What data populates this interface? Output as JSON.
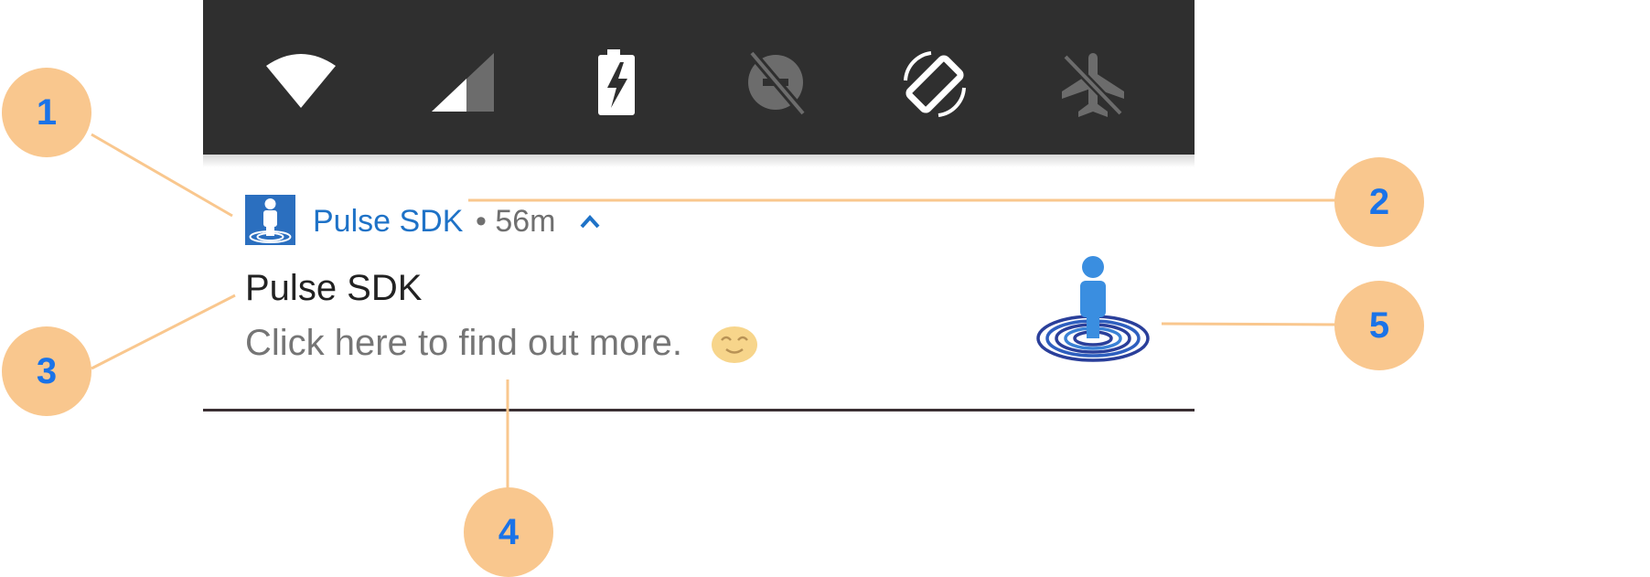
{
  "quick_settings": {
    "icons": [
      "wifi-icon",
      "cellular-signal-icon",
      "battery-charging-icon",
      "data-saver-off-icon",
      "auto-rotate-icon",
      "airplane-mode-off-icon"
    ],
    "background": "#2f2f2f"
  },
  "notification": {
    "app_name": "Pulse SDK",
    "time": "• 56m",
    "expand_icon": "chevron-up-icon",
    "title": "Pulse SDK",
    "text": "Click here to find out more.",
    "emoji": "smiling-face-emoji",
    "large_icon": "pulse-fingerprint-person-icon",
    "accent_color": "#1e72c7"
  },
  "callouts": [
    {
      "label": "1"
    },
    {
      "label": "2"
    },
    {
      "label": "3"
    },
    {
      "label": "4"
    },
    {
      "label": "5"
    }
  ],
  "colors": {
    "callout_fill": "#f9c78e",
    "callout_text": "#1a73e8",
    "leader_line": "#f9c78e"
  }
}
